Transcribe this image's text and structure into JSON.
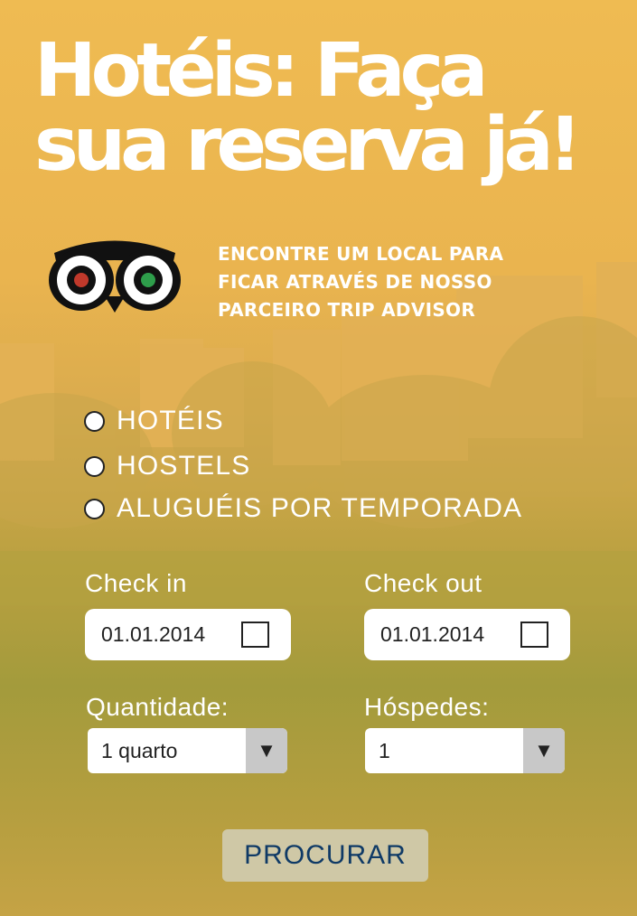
{
  "headline": {
    "line1": "Hotéis: Faça",
    "line2": "sua reserva já!"
  },
  "logo": {
    "icon": "owl-eyes-icon"
  },
  "tagline": {
    "line1": "ENCONTRE UM LOCAL PARA",
    "line2": "FICAR ATRAVÉS DE NOSSO",
    "line3": "PARCEIRO TRIP ADVISOR"
  },
  "options": [
    {
      "label": "HOTÉIS",
      "selected": false
    },
    {
      "label": "HOSTELS",
      "selected": false
    },
    {
      "label": "ALUGUÉIS POR TEMPORADA",
      "selected": false
    }
  ],
  "checkin": {
    "label": "Check in",
    "value": "01.01.2014",
    "icon": "calendar-icon"
  },
  "checkout": {
    "label": "Check out",
    "value": "01.01.2014",
    "icon": "calendar-icon"
  },
  "rooms": {
    "label": "Quantidade:",
    "value": "1 quarto",
    "icon": "dropdown-arrow-icon"
  },
  "guests": {
    "label": "Hóspedes:",
    "value": "1",
    "icon": "dropdown-arrow-icon"
  },
  "search_button": {
    "label": "PROCURAR"
  },
  "colors": {
    "overlay": "#efbb52",
    "button_text": "#0f3a66",
    "button_bg": "#cfc8a6"
  }
}
